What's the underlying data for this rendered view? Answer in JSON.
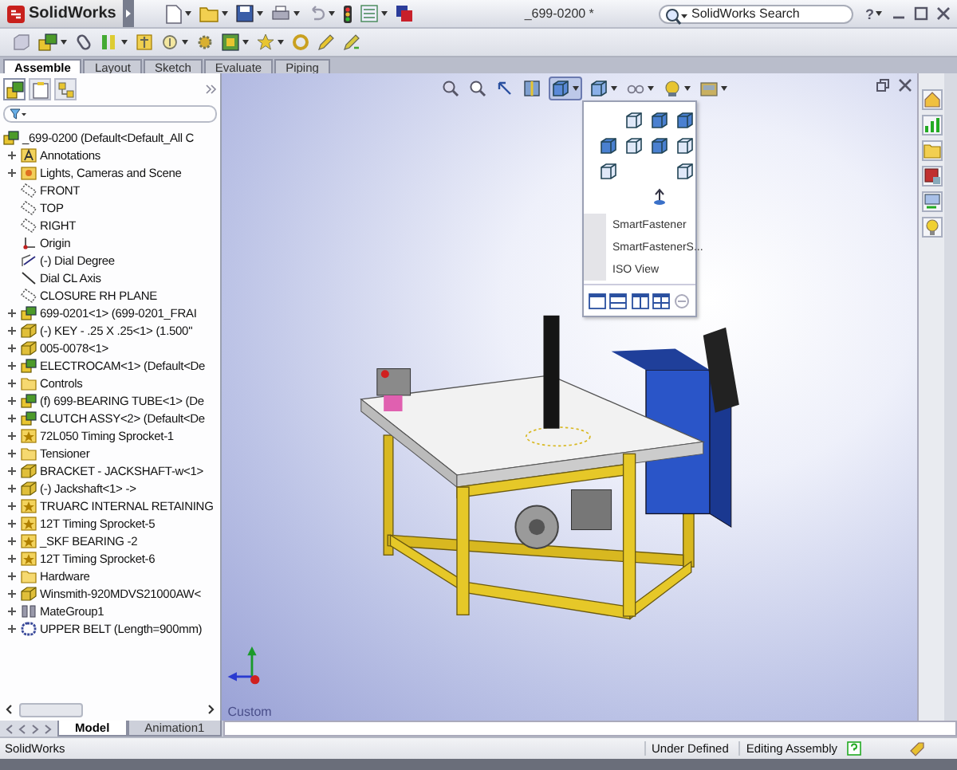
{
  "app": {
    "name": "SolidWorks"
  },
  "document_title": "_699-0200 *",
  "search": {
    "placeholder": "SolidWorks Search"
  },
  "help_label": "?",
  "command_tabs": [
    {
      "label": "Assemble",
      "selected": true
    },
    {
      "label": "Layout",
      "selected": false
    },
    {
      "label": "Sketch",
      "selected": false
    },
    {
      "label": "Evaluate",
      "selected": false
    },
    {
      "label": "Piping",
      "selected": false
    }
  ],
  "feature_tree": {
    "root": {
      "label": "_699-0200  (Default<Default_All C",
      "kind": "assembly",
      "children": [
        {
          "label": "Annotations",
          "kind": "annotations"
        },
        {
          "label": "Lights, Cameras and Scene",
          "kind": "lights"
        },
        {
          "label": "FRONT",
          "kind": "plane"
        },
        {
          "label": "TOP",
          "kind": "plane"
        },
        {
          "label": "RIGHT",
          "kind": "plane"
        },
        {
          "label": "Origin",
          "kind": "origin"
        },
        {
          "label": "(-) Dial Degree",
          "kind": "sketch"
        },
        {
          "label": "Dial CL Axis",
          "kind": "axis"
        },
        {
          "label": "CLOSURE RH PLANE",
          "kind": "plane"
        },
        {
          "label": "699-0201<1> (699-0201_FRAI",
          "kind": "assembly"
        },
        {
          "label": "(-) KEY - .25 X .25<1> (1.500\"",
          "kind": "part"
        },
        {
          "label": "005-0078<1>",
          "kind": "part"
        },
        {
          "label": "ELECTROCAM<1> (Default<De",
          "kind": "assembly"
        },
        {
          "label": "Controls",
          "kind": "folder"
        },
        {
          "label": "(f) 699-BEARING TUBE<1> (De",
          "kind": "assembly"
        },
        {
          "label": "CLUTCH ASSY<2> (Default<De",
          "kind": "assembly"
        },
        {
          "label": "72L050 Timing Sprocket-1",
          "kind": "toolbox"
        },
        {
          "label": "Tensioner",
          "kind": "folder"
        },
        {
          "label": "BRACKET - JACKSHAFT-w<1>",
          "kind": "part"
        },
        {
          "label": "(-) Jackshaft<1> ->",
          "kind": "part"
        },
        {
          "label": "TRUARC INTERNAL RETAINING",
          "kind": "toolbox"
        },
        {
          "label": "12T Timing Sprocket-5",
          "kind": "toolbox"
        },
        {
          "label": "_SKF BEARING -2",
          "kind": "toolbox"
        },
        {
          "label": "12T Timing Sprocket-6",
          "kind": "toolbox"
        },
        {
          "label": "Hardware",
          "kind": "folder"
        },
        {
          "label": "Winsmith-920MDVS21000AW<",
          "kind": "part"
        },
        {
          "label": "MateGroup1",
          "kind": "mates"
        },
        {
          "label": "UPPER BELT (Length=900mm)",
          "kind": "belt"
        }
      ]
    }
  },
  "view_menu": {
    "items": [
      {
        "label": "SmartFastener"
      },
      {
        "label": "SmartFastenerS..."
      },
      {
        "label": "ISO View"
      }
    ]
  },
  "viewport": {
    "view_name": "Custom"
  },
  "bottom_tabs": [
    {
      "label": "Model",
      "selected": true
    },
    {
      "label": "Animation1",
      "selected": false
    }
  ],
  "status_bar": {
    "app_label": "SolidWorks",
    "fields": [
      "Under Defined",
      "Editing Assembly"
    ]
  }
}
